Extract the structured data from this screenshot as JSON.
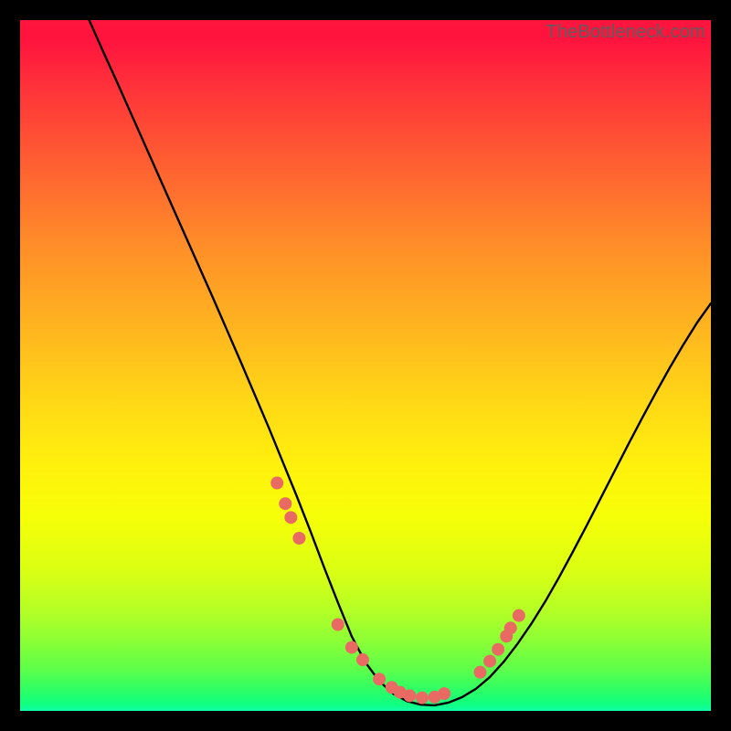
{
  "watermark": "TheBottleneck.com",
  "colors": {
    "background": "#000000",
    "curve": "#000000",
    "dots": "#e86a63",
    "gradient_stops": [
      "#ff153e",
      "#ff143e",
      "#ff2b3b",
      "#ff5c32",
      "#ff8f28",
      "#ffb61f",
      "#ffd716",
      "#fff20c",
      "#f6ff08",
      "#d9ff14",
      "#b0ff27",
      "#8aff36",
      "#5dff4a",
      "#2dff65",
      "#11ff80",
      "#0cffa9"
    ]
  },
  "chart_data": {
    "type": "line",
    "title": "",
    "xlabel": "",
    "ylabel": "",
    "xlim": [
      0,
      100
    ],
    "ylim": [
      0,
      100
    ],
    "grid": false,
    "notes": "Bottleneck-style V curve over vertical rainbow gradient. x/y in percent of inner plot box.",
    "series": [
      {
        "name": "curve",
        "x": [
          10,
          12,
          14,
          16,
          18,
          20,
          22,
          24,
          26,
          28,
          30,
          32,
          34,
          36,
          38,
          40,
          42,
          44,
          46,
          48,
          50,
          52,
          54,
          56,
          58,
          60,
          62,
          64,
          66,
          68,
          70,
          72,
          74,
          76,
          78,
          80,
          82,
          84,
          86,
          88,
          90,
          92,
          94,
          96,
          98,
          100
        ],
        "y": [
          100,
          95.5,
          91.1,
          86.6,
          82.1,
          77.6,
          73.1,
          68.6,
          64.1,
          59.6,
          55.0,
          50.4,
          45.7,
          41.0,
          36.1,
          31.2,
          26.1,
          20.8,
          15.7,
          10.8,
          7.0,
          4.3,
          2.5,
          1.4,
          0.9,
          0.8,
          1.2,
          2.0,
          3.2,
          4.9,
          7.1,
          9.7,
          12.6,
          15.8,
          19.3,
          23.0,
          26.8,
          30.7,
          34.6,
          38.5,
          42.3,
          46.0,
          49.6,
          53.0,
          56.2,
          59.0
        ]
      },
      {
        "name": "dots",
        "x": [
          37.2,
          38.4,
          39.2,
          40.4,
          46.0,
          48.0,
          49.6,
          52.0,
          53.8,
          55.0,
          56.4,
          58.2,
          60.0,
          61.4,
          66.6,
          68.0,
          69.2,
          70.4,
          71.0,
          72.2
        ],
        "y": [
          33.0,
          30.0,
          28.0,
          25.0,
          12.5,
          9.2,
          7.4,
          4.6,
          3.4,
          2.7,
          2.2,
          1.9,
          2.0,
          2.5,
          5.6,
          7.2,
          8.9,
          10.8,
          12.0,
          13.8
        ]
      }
    ]
  }
}
